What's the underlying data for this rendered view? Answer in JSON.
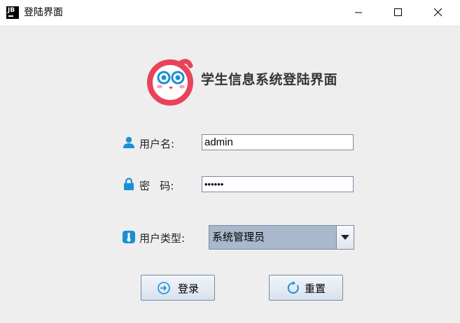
{
  "window": {
    "app_icon_text": "JB",
    "title": "登陆界面"
  },
  "header": {
    "title": "学生信息系统登陆界面"
  },
  "form": {
    "username": {
      "label": "用户名:",
      "value": "admin",
      "icon": "user-icon"
    },
    "password": {
      "label": "密   码:",
      "value": "••••••",
      "icon": "lock-icon"
    },
    "user_type": {
      "label": "用户类型:",
      "selected": "系统管理员",
      "icon": "user-type-icon"
    }
  },
  "buttons": {
    "login_label": "登录",
    "reset_label": "重置"
  },
  "colors": {
    "logo_ring": "#e8435a",
    "icon_blue": "#1a8fd6",
    "select_bg": "#a9b8cc"
  }
}
